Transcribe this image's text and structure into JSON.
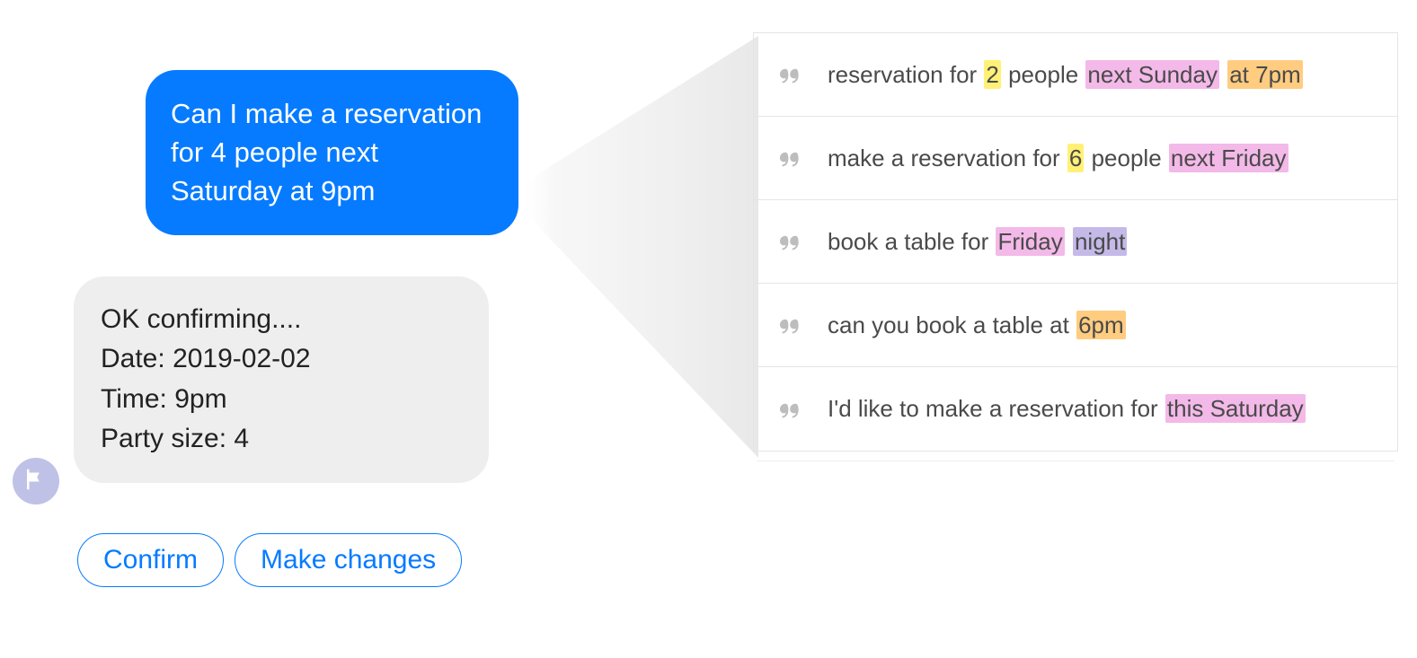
{
  "chat": {
    "user_message": "Can I make a reservation for 4 people next Saturday at 9pm",
    "bot_confirm_intro": "OK confirming....",
    "bot_date_label": "Date:",
    "bot_date_value": "2019-02-02",
    "bot_time_label": "Time:",
    "bot_time_value": "9pm",
    "bot_party_label": "Party size:",
    "bot_party_value": "4",
    "quick_replies": {
      "confirm": "Confirm",
      "make_changes": "Make changes"
    }
  },
  "examples": [
    {
      "segments": [
        {
          "text": "reservation for ",
          "hl": ""
        },
        {
          "text": "2",
          "hl": "yellow"
        },
        {
          "text": " people ",
          "hl": ""
        },
        {
          "text": "next Sunday",
          "hl": "pink"
        },
        {
          "text": " ",
          "hl": ""
        },
        {
          "text": "at 7pm",
          "hl": "orange"
        }
      ]
    },
    {
      "segments": [
        {
          "text": "make a reservation for ",
          "hl": ""
        },
        {
          "text": "6",
          "hl": "yellow"
        },
        {
          "text": " people ",
          "hl": ""
        },
        {
          "text": "next Friday",
          "hl": "pink"
        }
      ]
    },
    {
      "segments": [
        {
          "text": "book a table for ",
          "hl": ""
        },
        {
          "text": "Friday",
          "hl": "pink"
        },
        {
          "text": " ",
          "hl": ""
        },
        {
          "text": "night",
          "hl": "purple"
        }
      ]
    },
    {
      "segments": [
        {
          "text": "can you book a table at ",
          "hl": ""
        },
        {
          "text": "6pm",
          "hl": "orange"
        }
      ]
    },
    {
      "segments": [
        {
          "text": "I'd like to make a reservation for ",
          "hl": ""
        },
        {
          "text": "this Saturday",
          "hl": "pink"
        }
      ]
    }
  ],
  "colors": {
    "accent": "#067bff",
    "hl_yellow": "#fff176",
    "hl_pink": "#f3b9e8",
    "hl_orange": "#ffcc80",
    "hl_purple": "#c5b9e8"
  }
}
